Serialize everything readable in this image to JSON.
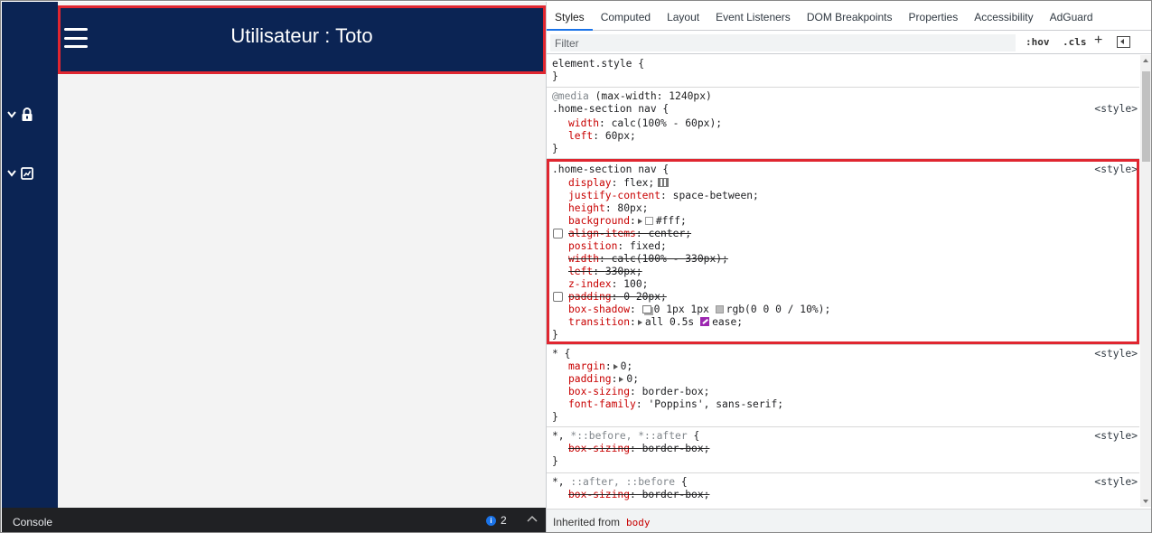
{
  "app": {
    "nav_title": "Utilisateur : Toto",
    "sidebar_icons": [
      "lock-icon",
      "chart-icon"
    ]
  },
  "console": {
    "label": "Console",
    "issue_count": "2"
  },
  "devtools": {
    "tabs": [
      "Styles",
      "Computed",
      "Layout",
      "Event Listeners",
      "DOM Breakpoints",
      "Properties",
      "Accessibility",
      "AdGuard"
    ],
    "active_tab": "Styles",
    "filter_placeholder": "Filter",
    "hov_label": ":hov",
    "cls_label": ".cls",
    "plus_label": "+",
    "inherited_label": "Inherited from",
    "inherited_element": "body",
    "rules": [
      {
        "selector": "element.style {",
        "source": "",
        "declarations": [],
        "close": "}"
      },
      {
        "media_keyword": "@media",
        "media_query": " (max-width: 1240px)",
        "selector": ".home-section nav {",
        "source": "<style>",
        "declarations": [
          {
            "prop": "width",
            "value": "calc(100% - 60px);"
          },
          {
            "prop": "left",
            "value": "60px;"
          }
        ],
        "close": "}"
      },
      {
        "selector": ".home-section nav {",
        "source": "<style>",
        "declarations": [
          {
            "prop": "display",
            "value": "flex;"
          },
          {
            "prop": "justify-content",
            "value": "space-between;"
          },
          {
            "prop": "height",
            "value": "80px;"
          },
          {
            "prop": "background",
            "value": "#fff;"
          },
          {
            "prop": "align-items",
            "value": "center;"
          },
          {
            "prop": "position",
            "value": "fixed;"
          },
          {
            "prop": "width",
            "value": "calc(100% - 330px);"
          },
          {
            "prop": "left",
            "value": "330px;"
          },
          {
            "prop": "z-index",
            "value": "100;"
          },
          {
            "prop": "padding",
            "value": "0 20px;"
          },
          {
            "prop": "box-shadow",
            "value": "0 1px 1px"
          },
          {
            "prop": "box-shadow-color",
            "value": "rgb(0 0 0 / 10%);"
          },
          {
            "prop": "transition",
            "value": "all 0.5s"
          },
          {
            "prop": "transition-ease",
            "value": "ease;"
          }
        ],
        "close": "}"
      },
      {
        "selector": "* {",
        "source": "<style>",
        "declarations": [
          {
            "prop": "margin",
            "value": "0;"
          },
          {
            "prop": "padding",
            "value": "0;"
          },
          {
            "prop": "box-sizing",
            "value": "border-box;"
          },
          {
            "prop": "font-family",
            "value": "'Poppins', sans-serif;"
          }
        ],
        "close": "}"
      },
      {
        "selector_main": "*, ",
        "selector_muted": "*::before, *::after",
        "selector_end": " {",
        "source": "<style>",
        "declarations": [
          {
            "prop": "box-sizing",
            "value": "border-box;"
          }
        ],
        "close": "}"
      },
      {
        "selector_main": "*, ",
        "selector_muted": "::after, ::before",
        "selector_end": " {",
        "source": "<style>",
        "declarations": [
          {
            "prop": "box-sizing",
            "value": "border-box;"
          }
        ]
      }
    ]
  },
  "colors": {
    "nav_bg": "#0b2454",
    "highlight": "#e02630",
    "property": "#c80000",
    "tab_active": "#1a73e8"
  }
}
